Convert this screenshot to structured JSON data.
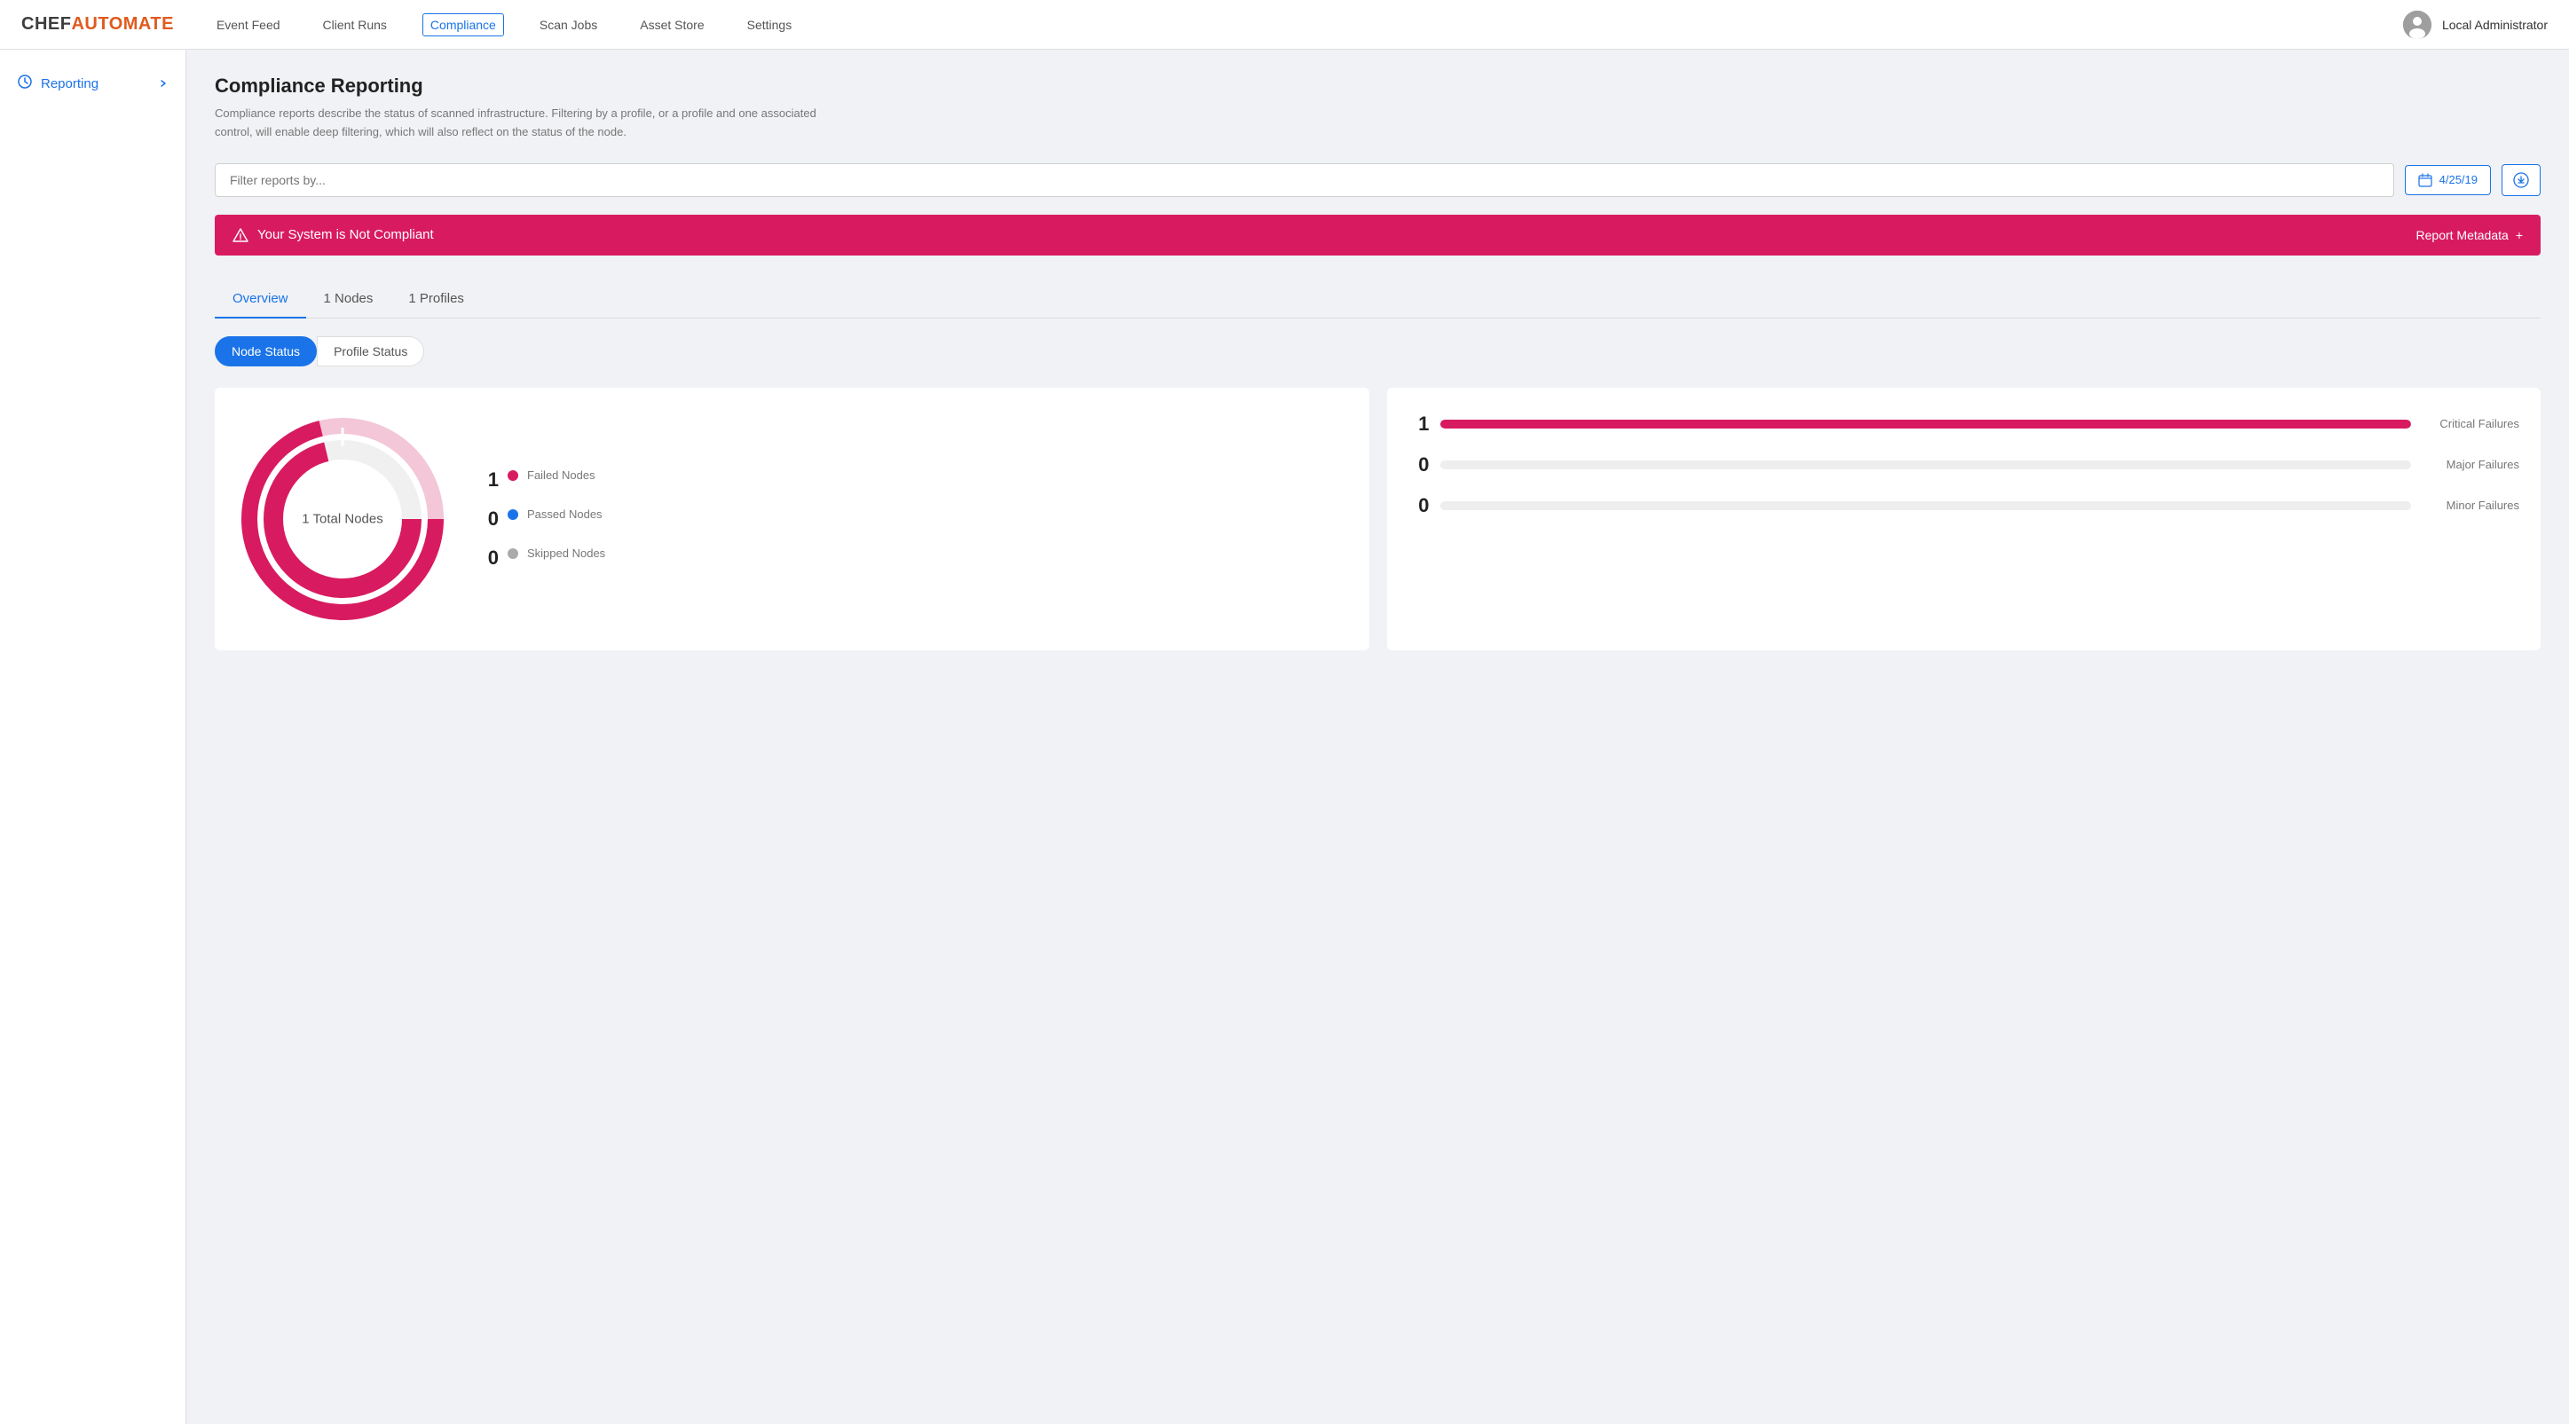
{
  "logo": {
    "chef": "CHEF",
    "automate": "AUTOMATE"
  },
  "nav": {
    "links": [
      {
        "label": "Event Feed",
        "active": false
      },
      {
        "label": "Client Runs",
        "active": false
      },
      {
        "label": "Compliance",
        "active": true
      },
      {
        "label": "Scan Jobs",
        "active": false
      },
      {
        "label": "Asset Store",
        "active": false
      },
      {
        "label": "Settings",
        "active": false
      }
    ],
    "user_name": "Local Administrator"
  },
  "sidebar": {
    "items": [
      {
        "label": "Reporting",
        "icon": "reporting-icon",
        "arrow": true
      }
    ]
  },
  "main": {
    "title": "Compliance Reporting",
    "description": "Compliance reports describe the status of scanned infrastructure. Filtering by a profile, or a profile and one associated control, will enable deep filtering, which will also reflect on the status of the node.",
    "filter_placeholder": "Filter reports by...",
    "date_label": "4/25/19",
    "banner": {
      "message": "Your System is Not Compliant",
      "action": "Report Metadata",
      "action_symbol": "+"
    },
    "tabs": [
      {
        "label": "Overview",
        "active": true
      },
      {
        "label": "1 Nodes",
        "active": false
      },
      {
        "label": "1 Profiles",
        "active": false
      }
    ],
    "toggles": [
      {
        "label": "Node Status",
        "active": true
      },
      {
        "label": "Profile Status",
        "active": false
      }
    ],
    "donut_chart": {
      "center_label": "1 Total Nodes",
      "legend": [
        {
          "count": "1",
          "label": "Failed Nodes",
          "color": "#d81b60"
        },
        {
          "count": "0",
          "label": "Passed Nodes",
          "color": "#1a73e8"
        },
        {
          "count": "0",
          "label": "Skipped Nodes",
          "color": "#aaa"
        }
      ]
    },
    "bar_chart": {
      "bars": [
        {
          "count": "1",
          "label": "Critical Failures",
          "fill_pct": 100,
          "color": "#d81b60"
        },
        {
          "count": "0",
          "label": "Major Failures",
          "fill_pct": 0,
          "color": "#e0e0e0"
        },
        {
          "count": "0",
          "label": "Minor Failures",
          "fill_pct": 0,
          "color": "#e0e0e0"
        }
      ]
    }
  },
  "colors": {
    "pink": "#d81b60",
    "blue": "#1a73e8",
    "orange": "#e05a1e",
    "gray": "#aaa",
    "light_gray": "#e0e0e0"
  }
}
